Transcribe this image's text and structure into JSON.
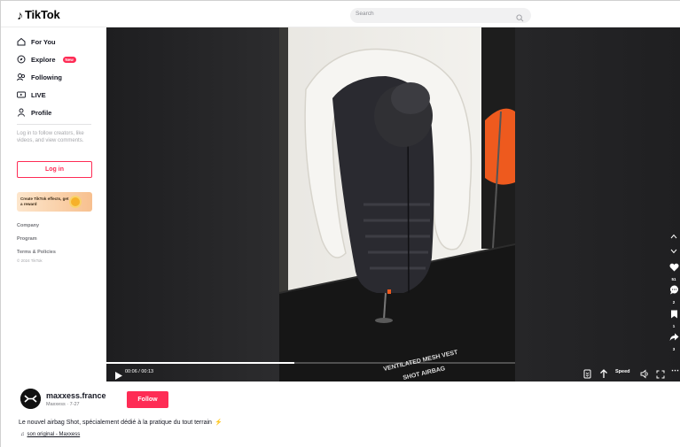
{
  "header": {
    "logo_text": "TikTok",
    "search_placeholder": "Search"
  },
  "sidebar": {
    "items": [
      {
        "label": "For You",
        "icon": "home-icon"
      },
      {
        "label": "Explore",
        "icon": "compass-icon",
        "badge": "New"
      },
      {
        "label": "Following",
        "icon": "following-icon"
      },
      {
        "label": "LIVE",
        "icon": "live-icon"
      },
      {
        "label": "Profile",
        "icon": "profile-icon"
      }
    ],
    "login_message": "Log in to follow creators, like videos, and view comments.",
    "login_button": "Log in",
    "effects_banner": "Create TikTok effects, get a reward",
    "footer_links": [
      "Company",
      "Program",
      "Terms & Policies"
    ],
    "copyright": "© 2024 TikTok"
  },
  "video": {
    "time": "00:06 / 00:13",
    "speed_label": "Speed",
    "progress": 0.46,
    "overlay_text_line1": "VENTILATED MESH VEST",
    "overlay_text_line2": "SHOT AIRBAG"
  },
  "actions": {
    "likes": "51",
    "comments": "2",
    "saves": "1",
    "shares": "3"
  },
  "post": {
    "username": "maxxess.france",
    "subline": "Maxxess · 7-27",
    "follow_label": "Follow",
    "caption": "Le nouvel airbag Shot, spécialement dédié à la pratique du tout terrain",
    "caption_emoji": "⚡",
    "music_icon": "♫",
    "music": "son original - Maxxess"
  },
  "colors": {
    "accent": "#fe2c55",
    "text": "#161823",
    "video_bg": "#212123"
  }
}
